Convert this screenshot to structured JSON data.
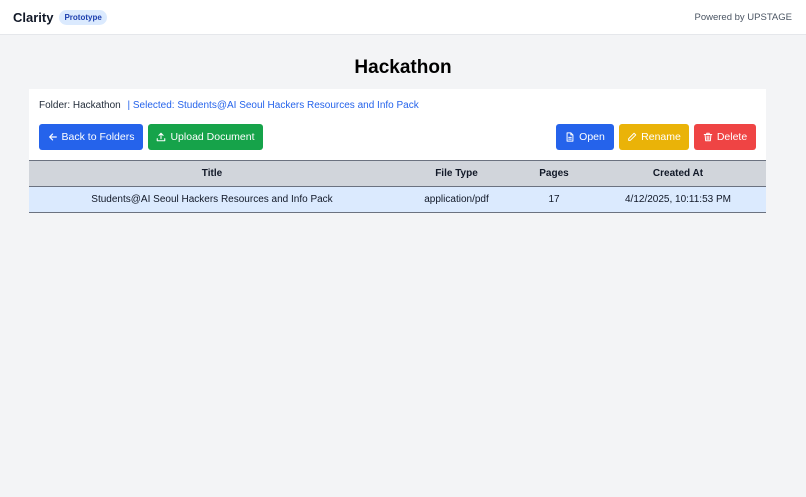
{
  "app": {
    "name": "Clarity",
    "badge": "Prototype",
    "powered_by": "Powered by UPSTAGE"
  },
  "page": {
    "title": "Hackathon",
    "folder_label": "Folder: Hackathon",
    "selected_label": "| Selected: Students@AI Seoul Hackers Resources and Info Pack"
  },
  "toolbar": {
    "back_label": "Back to Folders",
    "upload_label": "Upload Document",
    "open_label": "Open",
    "rename_label": "Rename",
    "delete_label": "Delete",
    "back_icon": "arrow-left-icon",
    "upload_icon": "upload-icon",
    "open_icon": "document-icon",
    "rename_icon": "pencil-icon",
    "delete_icon": "trash-icon"
  },
  "table": {
    "columns": [
      "Title",
      "File Type",
      "Pages",
      "Created At"
    ],
    "rows": [
      {
        "title": "Students@AI Seoul Hackers Resources and Info Pack",
        "file_type": "application/pdf",
        "pages": "17",
        "created_at": "4/12/2025, 10:11:53 PM",
        "selected": true
      }
    ]
  },
  "colors": {
    "primary": "#2563eb",
    "success": "#16a34a",
    "warning": "#eab308",
    "danger": "#ef4444",
    "selected_row": "#dbeafe",
    "background": "#f3f4f6"
  }
}
